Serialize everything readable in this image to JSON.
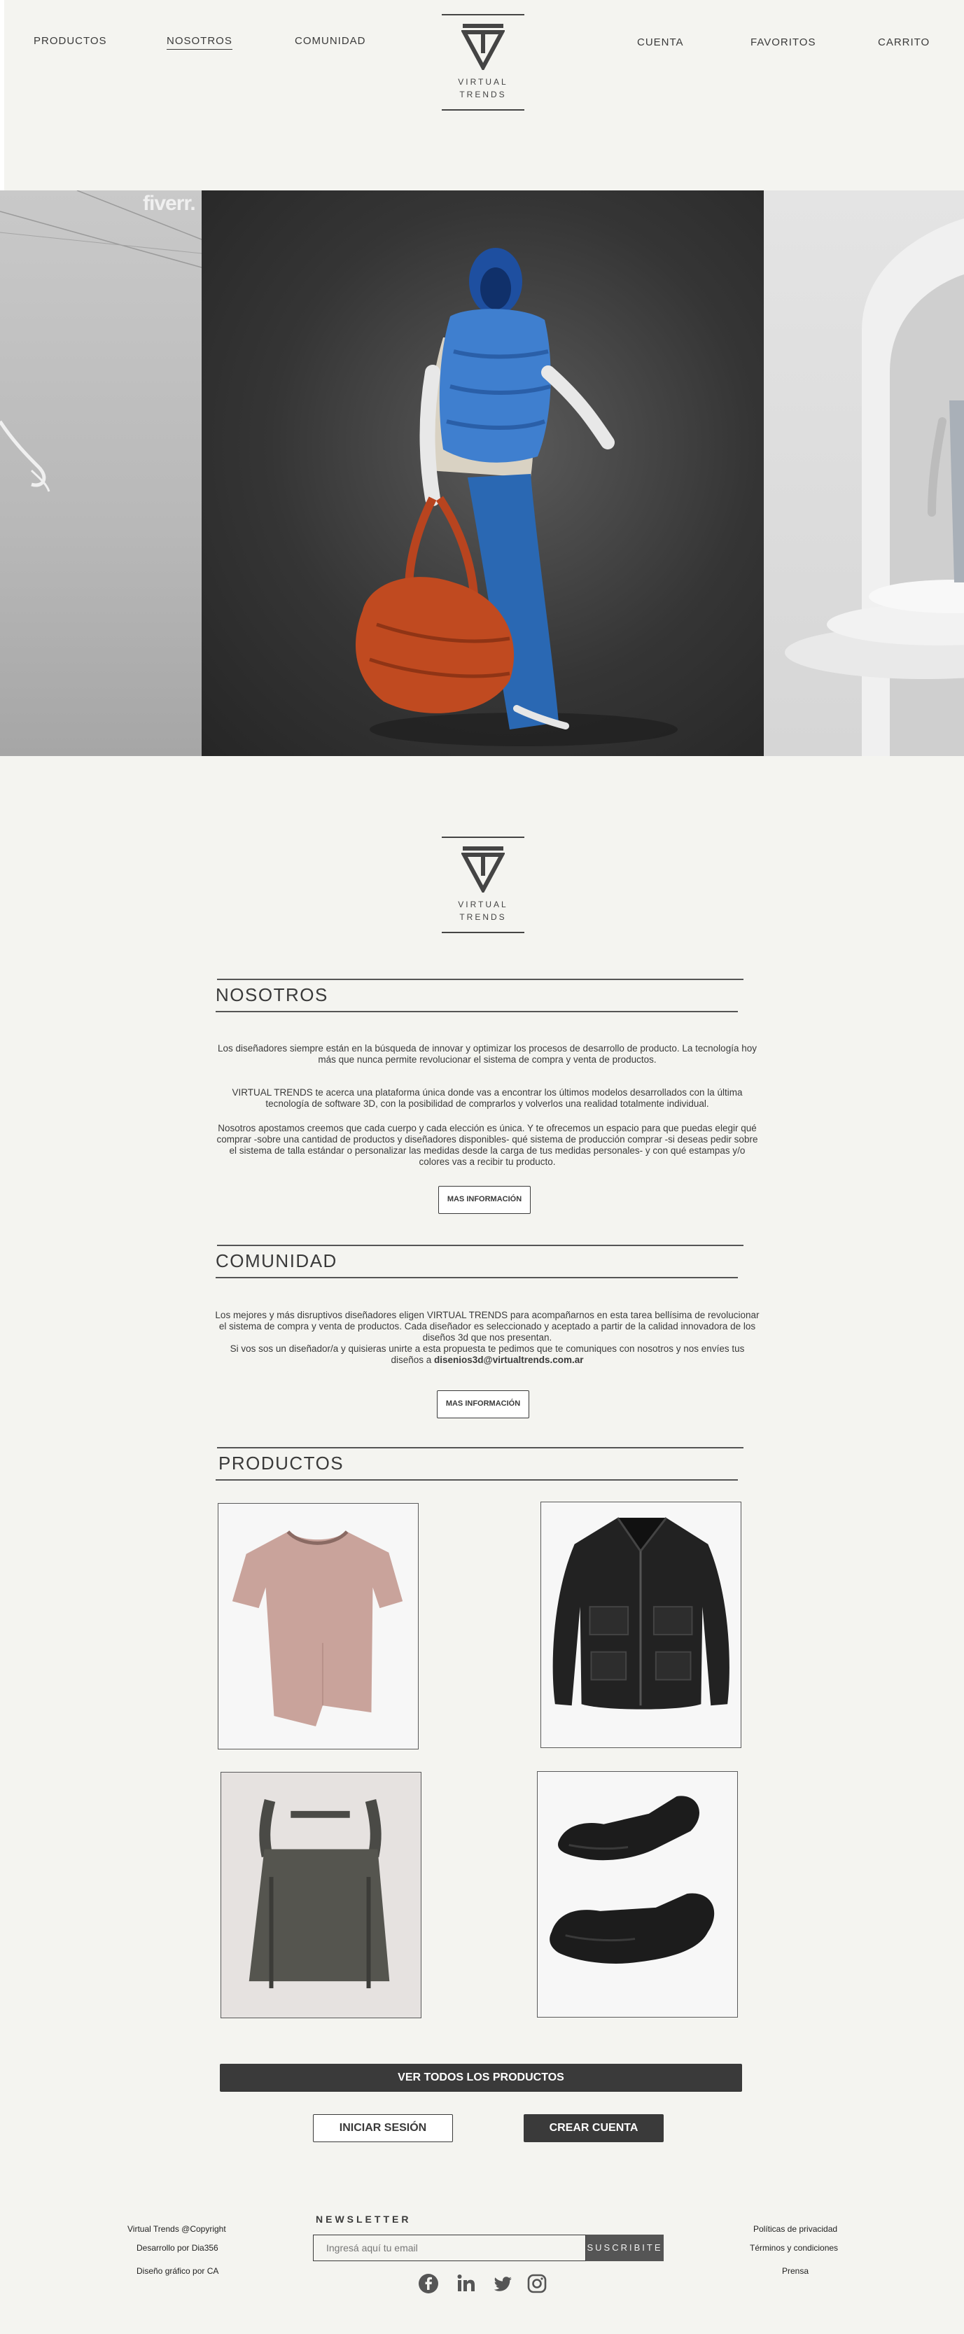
{
  "nav": {
    "left_links": [
      {
        "label": "PRODUCTOS",
        "active": false
      },
      {
        "label": "NOSOTROS",
        "active": true
      },
      {
        "label": "COMUNIDAD",
        "active": false
      }
    ],
    "right_links": [
      {
        "label": "CUENTA"
      },
      {
        "label": "FAVORITOS"
      },
      {
        "label": "CARRITO"
      }
    ]
  },
  "logo": {
    "line1": "VIRTUAL",
    "line2": "TRENDS"
  },
  "hero": {
    "watermark": "fiverr."
  },
  "about": {
    "title": "NOSOTROS",
    "paragraph1": "Los diseñadores siempre están en la búsqueda de innovar y optimizar los procesos de desarrollo de producto. La tecnología hoy más que nunca permite revolucionar el sistema de compra y venta de productos.",
    "paragraph2": "VIRTUAL TRENDS te acerca una plataforma única donde vas a encontrar los últimos modelos desarrollados con la última tecnología de software 3D, con la posibilidad de comprarlos y volverlos una realidad totalmente individual.",
    "paragraph3": "Nosotros apostamos creemos que cada cuerpo y cada elección es única. Y te ofrecemos un espacio para que puedas elegir qué comprar -sobre una cantidad de productos y diseñadores disponibles- qué sistema de producción comprar -si deseas pedir sobre el sistema de talla estándar o personalizar las medidas desde la carga de tus medidas personales- y con qué estampas y/o colores vas a recibir tu producto.",
    "button": "MAS INFORMACIÓN"
  },
  "community": {
    "title": "COMUNIDAD",
    "paragraph1": "Los mejores y más disruptivos diseñadores eligen VIRTUAL TRENDS para acompañarnos en esta tarea bellísima de revolucionar el sistema de compra y venta de productos. Cada diseñador es seleccionado y aceptado a partir de la calidad innovadora de los diseños 3d que nos presentan.",
    "paragraph2_prefix": "Si vos sos un diseñador/a y quisieras unirte a esta propuesta te pedimos que te comuniques con nosotros y nos envíes tus diseños a ",
    "email": "disenios3d@virtualtrends.com.ar",
    "button": "MAS INFORMACIÓN"
  },
  "products": {
    "title": "PRODUCTOS",
    "items": [
      {
        "name": "pink-tshirt"
      },
      {
        "name": "black-leather-jacket"
      },
      {
        "name": "grey-backpack"
      },
      {
        "name": "black-leather-gloves"
      }
    ],
    "view_all": "VER TODOS LOS PRODUCTOS",
    "login": "INICIAR SESIÓN",
    "signup": "CREAR CUENTA"
  },
  "footer": {
    "left": [
      "Virtual Trends @Copyright",
      "Desarrollo por Dia356",
      "Diseño gráfico por CA"
    ],
    "newsletter_title": "NEWSLETTER",
    "newsletter_placeholder": "Ingresá aquí tu email",
    "newsletter_button": "SUSCRIBITE",
    "social": [
      "facebook-icon",
      "linkedin-icon",
      "twitter-icon",
      "instagram-icon"
    ],
    "right": [
      "Políticas de privacidad",
      "Términos y condiciones",
      "Prensa"
    ]
  },
  "colors": {
    "background": "#f4f4f0",
    "dark": "#3a3a3a",
    "accent_blue": "#3f7fcf",
    "accent_orange": "#b8441f"
  }
}
